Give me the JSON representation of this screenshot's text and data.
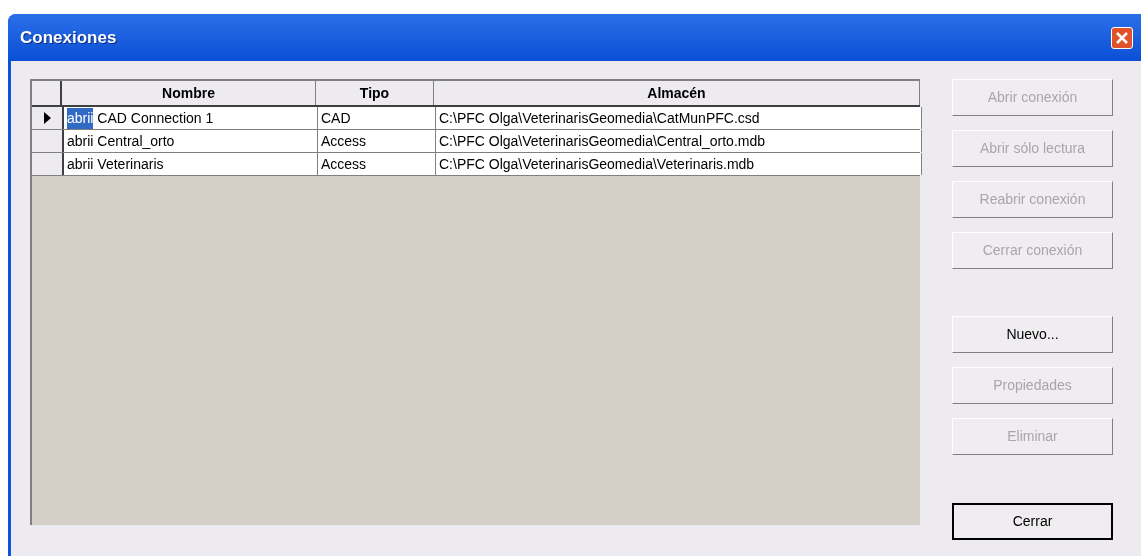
{
  "window": {
    "title": "Conexiones"
  },
  "table": {
    "columns": [
      "Nombre",
      "Tipo",
      "Almacén"
    ],
    "rows": [
      {
        "selected": true,
        "editing": true,
        "prefix": "abrii",
        "name": "CAD Connection 1",
        "tipo": "CAD",
        "almacen": "C:\\PFC Olga\\VeterinarisGeomedia\\CatMunPFC.csd"
      },
      {
        "selected": false,
        "editing": false,
        "prefix": "abrii",
        "name": "Central_orto",
        "tipo": "Access",
        "almacen": "C:\\PFC Olga\\VeterinarisGeomedia\\Central_orto.mdb"
      },
      {
        "selected": false,
        "editing": false,
        "prefix": "abrii",
        "name": "Veterinaris",
        "tipo": "Access",
        "almacen": "C:\\PFC Olga\\VeterinarisGeomedia\\Veterinaris.mdb"
      }
    ]
  },
  "buttons": [
    {
      "label": "Abrir conexión",
      "disabled": true,
      "default": false
    },
    {
      "label": "Abrir sólo lectura",
      "disabled": true,
      "default": false
    },
    {
      "label": "Reabrir conexión",
      "disabled": true,
      "default": false
    },
    {
      "label": "Cerrar conexión",
      "disabled": true,
      "default": false
    },
    {
      "label": "Nuevo...",
      "disabled": false,
      "default": false
    },
    {
      "label": "Propiedades",
      "disabled": true,
      "default": false
    },
    {
      "label": "Eliminar",
      "disabled": true,
      "default": false
    },
    {
      "label": "Cerrar",
      "disabled": false,
      "default": true
    }
  ]
}
